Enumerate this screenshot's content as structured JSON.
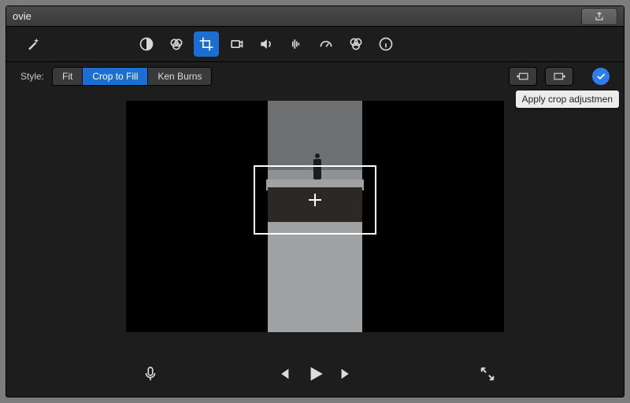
{
  "titlebar": {
    "title": "ovie"
  },
  "toolbar": {
    "icons": [
      "magic-wand",
      "contrast",
      "color-palette",
      "crop",
      "camera",
      "volume",
      "audio-levels",
      "speedometer",
      "color-filter",
      "info"
    ],
    "active": "crop"
  },
  "style": {
    "label": "Style:",
    "options": {
      "fit": "Fit",
      "crop_to_fill": "Crop to Fill",
      "ken_burns": "Ken Burns"
    },
    "selected": "crop_to_fill"
  },
  "rotate": {
    "ccw": "rotate-ccw",
    "cw": "rotate-cw"
  },
  "apply": {
    "tooltip": "Apply crop adjustmen"
  },
  "controls": {
    "mic": "microphone",
    "prev": "previous",
    "play": "play",
    "next": "next",
    "fullscreen": "fullscreen"
  }
}
